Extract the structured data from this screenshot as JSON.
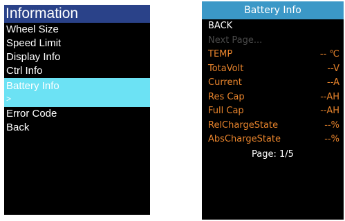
{
  "left": {
    "title": "Information",
    "items": [
      {
        "label": "Wheel Size"
      },
      {
        "label": "Speed Limit"
      },
      {
        "label": "Display Info"
      },
      {
        "label": "Ctrl Info"
      },
      {
        "label": "Battery Info",
        "sub": ">"
      },
      {
        "label": "Error Code"
      },
      {
        "label": "Back"
      }
    ],
    "colors": {
      "header_bg": "#2a4289",
      "selected_bg": "#6ce2f4"
    }
  },
  "right": {
    "title": "Battery Info",
    "back_label": "BACK",
    "next_label": "Next Page...",
    "rows": [
      {
        "label": "TEMP",
        "value": "-- ℃"
      },
      {
        "label": "TotaVolt",
        "value": "--V"
      },
      {
        "label": "Current",
        "value": "--A"
      },
      {
        "label": "Res Cap",
        "value": "--AH"
      },
      {
        "label": "Full Cap",
        "value": "--AH"
      },
      {
        "label": "RelChargeState",
        "value": "--%"
      },
      {
        "label": "AbsChargeState",
        "value": "--%"
      }
    ],
    "page": "Page: 1/5",
    "colors": {
      "header_bg": "#3b98c7",
      "data_text": "#e8842c"
    }
  }
}
